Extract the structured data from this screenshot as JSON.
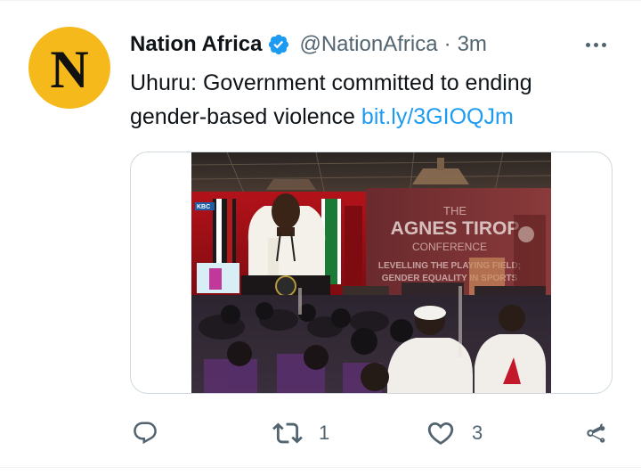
{
  "tweet": {
    "author": {
      "name": "Nation Africa",
      "handle": "@NationAfrica",
      "avatar_letter": "N",
      "avatar_color": "#f6b91b",
      "verified": true
    },
    "separator": "·",
    "time": "3m",
    "text": "Uhuru: Government committed to ending gender-based violence",
    "link": "bit.ly/3GIOQJm",
    "media": {
      "screen_text": {
        "line1": "THE",
        "line2": "AGNES TIROP",
        "line3": "CONFERENCE",
        "line4": "LEVELLING THE PLAYING FIELD;",
        "line5": "GENDER EQUALITY IN SPORTS",
        "channel": "KBC"
      }
    },
    "actions": {
      "reply": {
        "icon": "reply-icon",
        "count": ""
      },
      "retweet": {
        "icon": "retweet-icon",
        "count": "1"
      },
      "like": {
        "icon": "heart-icon",
        "count": "3"
      },
      "share": {
        "icon": "share-icon",
        "count": ""
      }
    }
  },
  "colors": {
    "accent": "#1d9bf0",
    "text_secondary": "#536471",
    "border": "#cfd9de",
    "verified_badge": "#1d9bf0"
  }
}
